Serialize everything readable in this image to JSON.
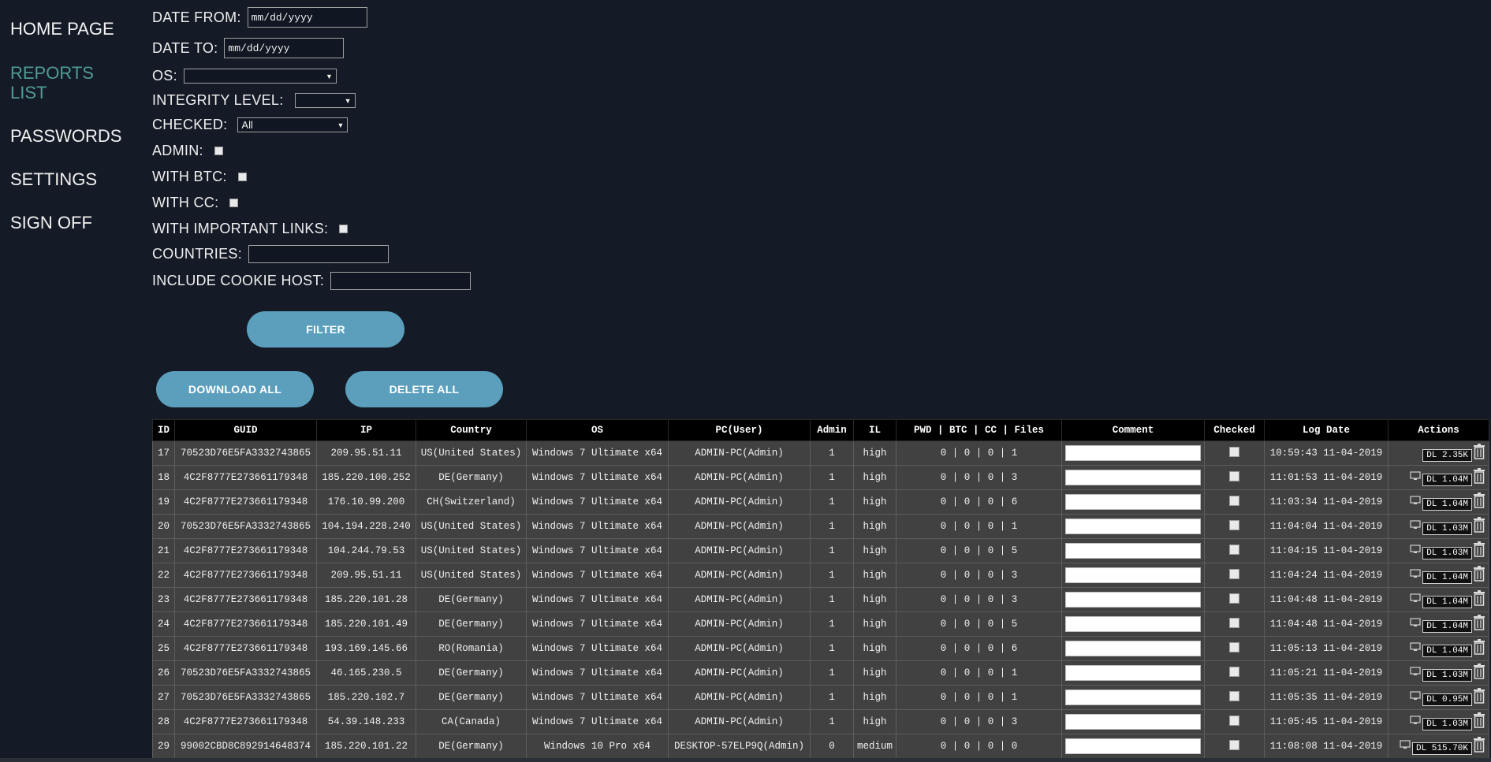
{
  "nav": {
    "home": "HOME PAGE",
    "reports": "REPORTS LIST",
    "passwords": "PASSWORDS",
    "settings": "SETTINGS",
    "signoff": "SIGN OFF"
  },
  "filters": {
    "date_from_label": "DATE FROM:",
    "date_from_placeholder": "mm/dd/yyyy",
    "date_to_label": "DATE TO:",
    "date_to_placeholder": "mm/dd/yyyy",
    "os_label": "OS:",
    "os_value": "",
    "integrity_label": "INTEGRITY LEVEL:",
    "integrity_value": "",
    "checked_label": "CHECKED:",
    "checked_value": "All",
    "admin_label": "ADMIN:",
    "btc_label": "WITH BTC:",
    "cc_label": "WITH CC:",
    "links_label": "WITH IMPORTANT LINKS:",
    "countries_label": "COUNTRIES:",
    "cookie_label": "INCLUDE COOKIE HOST:"
  },
  "buttons": {
    "filter": "FILTER",
    "download_all": "DOWNLOAD ALL",
    "delete_all": "DELETE ALL"
  },
  "table": {
    "headers": [
      "ID",
      "GUID",
      "IP",
      "Country",
      "OS",
      "PC(User)",
      "Admin",
      "IL",
      "PWD | BTC | CC | Files",
      "Comment",
      "Checked",
      "Log Date",
      "Actions"
    ],
    "rows": [
      {
        "id": "17",
        "guid": "70523D76E5FA3332743865",
        "ip": "209.95.51.11",
        "country": "US(United States)",
        "os": "Windows 7 Ultimate x64",
        "pc": "ADMIN-PC(Admin)",
        "admin": "1",
        "il": "high",
        "stats": "0 | 0 | 0 | 1",
        "date": "10:59:43 11-04-2019",
        "dl": "DL 2.35K",
        "screen": false
      },
      {
        "id": "18",
        "guid": "4C2F8777E273661179348",
        "ip": "185.220.100.252",
        "country": "DE(Germany)",
        "os": "Windows 7 Ultimate x64",
        "pc": "ADMIN-PC(Admin)",
        "admin": "1",
        "il": "high",
        "stats": "0 | 0 | 0 | 3",
        "date": "11:01:53 11-04-2019",
        "dl": "DL 1.04M",
        "screen": true
      },
      {
        "id": "19",
        "guid": "4C2F8777E273661179348",
        "ip": "176.10.99.200",
        "country": "CH(Switzerland)",
        "os": "Windows 7 Ultimate x64",
        "pc": "ADMIN-PC(Admin)",
        "admin": "1",
        "il": "high",
        "stats": "0 | 0 | 0 | 6",
        "date": "11:03:34 11-04-2019",
        "dl": "DL 1.04M",
        "screen": true
      },
      {
        "id": "20",
        "guid": "70523D76E5FA3332743865",
        "ip": "104.194.228.240",
        "country": "US(United States)",
        "os": "Windows 7 Ultimate x64",
        "pc": "ADMIN-PC(Admin)",
        "admin": "1",
        "il": "high",
        "stats": "0 | 0 | 0 | 1",
        "date": "11:04:04 11-04-2019",
        "dl": "DL 1.03M",
        "screen": true
      },
      {
        "id": "21",
        "guid": "4C2F8777E273661179348",
        "ip": "104.244.79.53",
        "country": "US(United States)",
        "os": "Windows 7 Ultimate x64",
        "pc": "ADMIN-PC(Admin)",
        "admin": "1",
        "il": "high",
        "stats": "0 | 0 | 0 | 5",
        "date": "11:04:15 11-04-2019",
        "dl": "DL 1.03M",
        "screen": true
      },
      {
        "id": "22",
        "guid": "4C2F8777E273661179348",
        "ip": "209.95.51.11",
        "country": "US(United States)",
        "os": "Windows 7 Ultimate x64",
        "pc": "ADMIN-PC(Admin)",
        "admin": "1",
        "il": "high",
        "stats": "0 | 0 | 0 | 3",
        "date": "11:04:24 11-04-2019",
        "dl": "DL 1.04M",
        "screen": true
      },
      {
        "id": "23",
        "guid": "4C2F8777E273661179348",
        "ip": "185.220.101.28",
        "country": "DE(Germany)",
        "os": "Windows 7 Ultimate x64",
        "pc": "ADMIN-PC(Admin)",
        "admin": "1",
        "il": "high",
        "stats": "0 | 0 | 0 | 3",
        "date": "11:04:48 11-04-2019",
        "dl": "DL 1.04M",
        "screen": true
      },
      {
        "id": "24",
        "guid": "4C2F8777E273661179348",
        "ip": "185.220.101.49",
        "country": "DE(Germany)",
        "os": "Windows 7 Ultimate x64",
        "pc": "ADMIN-PC(Admin)",
        "admin": "1",
        "il": "high",
        "stats": "0 | 0 | 0 | 5",
        "date": "11:04:48 11-04-2019",
        "dl": "DL 1.04M",
        "screen": true
      },
      {
        "id": "25",
        "guid": "4C2F8777E273661179348",
        "ip": "193.169.145.66",
        "country": "RO(Romania)",
        "os": "Windows 7 Ultimate x64",
        "pc": "ADMIN-PC(Admin)",
        "admin": "1",
        "il": "high",
        "stats": "0 | 0 | 0 | 6",
        "date": "11:05:13 11-04-2019",
        "dl": "DL 1.04M",
        "screen": true
      },
      {
        "id": "26",
        "guid": "70523D76E5FA3332743865",
        "ip": "46.165.230.5",
        "country": "DE(Germany)",
        "os": "Windows 7 Ultimate x64",
        "pc": "ADMIN-PC(Admin)",
        "admin": "1",
        "il": "high",
        "stats": "0 | 0 | 0 | 1",
        "date": "11:05:21 11-04-2019",
        "dl": "DL 1.03M",
        "screen": true
      },
      {
        "id": "27",
        "guid": "70523D76E5FA3332743865",
        "ip": "185.220.102.7",
        "country": "DE(Germany)",
        "os": "Windows 7 Ultimate x64",
        "pc": "ADMIN-PC(Admin)",
        "admin": "1",
        "il": "high",
        "stats": "0 | 0 | 0 | 1",
        "date": "11:05:35 11-04-2019",
        "dl": "DL 0.95M",
        "screen": true
      },
      {
        "id": "28",
        "guid": "4C2F8777E273661179348",
        "ip": "54.39.148.233",
        "country": "CA(Canada)",
        "os": "Windows 7 Ultimate x64",
        "pc": "ADMIN-PC(Admin)",
        "admin": "1",
        "il": "high",
        "stats": "0 | 0 | 0 | 3",
        "date": "11:05:45 11-04-2019",
        "dl": "DL 1.03M",
        "screen": true
      },
      {
        "id": "29",
        "guid": "99002CBD8C892914648374",
        "ip": "185.220.101.22",
        "country": "DE(Germany)",
        "os": "Windows 10 Pro x64",
        "pc": "DESKTOP-57ELP9Q(Admin)",
        "admin": "0",
        "il": "medium",
        "stats": "0 | 0 | 0 | 0",
        "date": "11:08:08 11-04-2019",
        "dl": "DL 515.70K",
        "screen": true
      }
    ]
  },
  "colors": {
    "background": "#151b26",
    "active_nav": "#4f9a96",
    "button": "#5b9fbd",
    "table_header": "#000000",
    "table_row": "#414141"
  }
}
